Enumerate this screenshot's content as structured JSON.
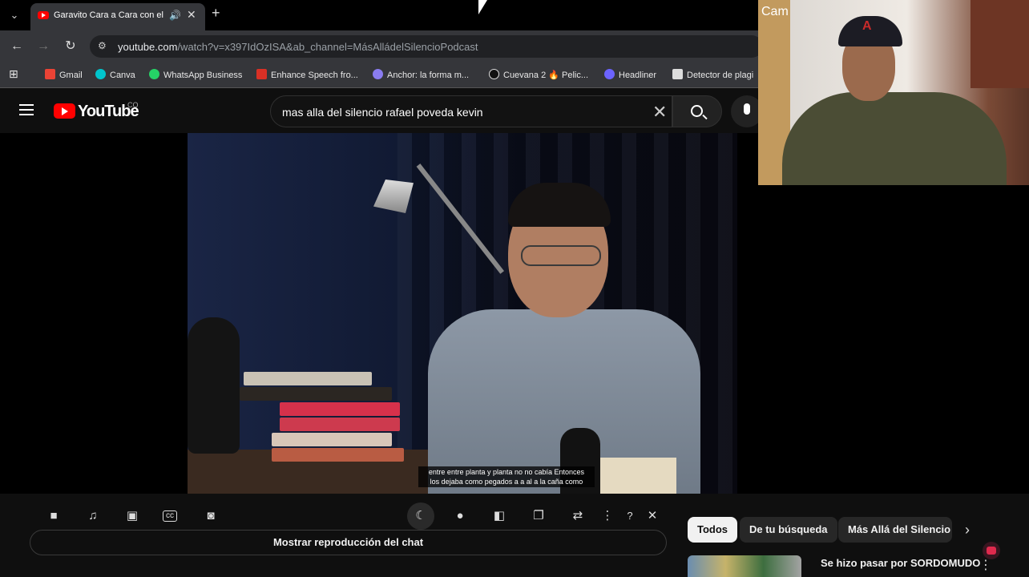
{
  "browser": {
    "tab": {
      "title": "Garavito Cara a Cara con el"
    },
    "url_host": "youtube.com",
    "url_path": "/watch?v=x397IdOzISA&ab_channel=MásAlládelSilencioPodcast",
    "bookmarks": [
      {
        "label": "Gmail",
        "color": "#ea4335"
      },
      {
        "label": "Canva",
        "color": "#00c4cc"
      },
      {
        "label": "WhatsApp Business",
        "color": "#25d366"
      },
      {
        "label": "Enhance Speech fro...",
        "color": "#d93025"
      },
      {
        "label": "Anchor: la forma m...",
        "color": "#8a7cf0"
      },
      {
        "label": "Cuevana 2 🔥 Pelic...",
        "color": "#111111"
      },
      {
        "label": "Headliner",
        "color": "#6c63ff"
      },
      {
        "label": "Detector de plagi",
        "color": "#dddddd"
      }
    ]
  },
  "youtube": {
    "logo_text": "YouTube",
    "country": "CO",
    "search_query": "mas alla del silencio rafael poveda kevin"
  },
  "video": {
    "caption_line1": "entre entre planta y planta no no cabía Entonces",
    "caption_line2": "los dejaba como pegados a a al a la caña como"
  },
  "webcam": {
    "overlay_text": "Cam"
  },
  "player": {
    "chat_replay_label": "Mostrar reproducción del chat"
  },
  "sidebar": {
    "chips": [
      "Todos",
      "De tu búsqueda",
      "Más Allá del Silencio"
    ],
    "recommendation_title": "Se hizo pasar por SORDOMUDO"
  }
}
